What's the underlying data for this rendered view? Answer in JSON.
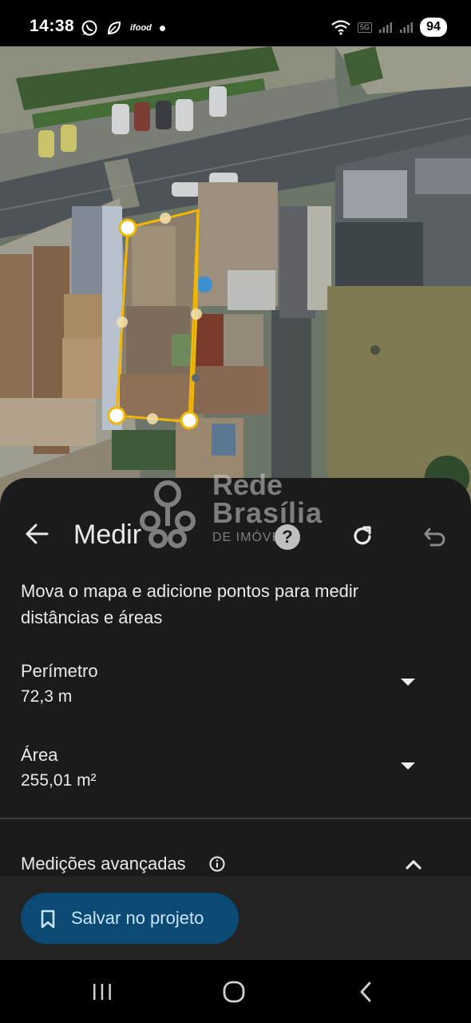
{
  "status_bar": {
    "time": "14:38",
    "left_icons": [
      "whatsapp-icon",
      "leaf-icon",
      "ifood-icon",
      "dot-icon"
    ],
    "ifood_label": "ifood",
    "network_label": "5G",
    "battery": "94"
  },
  "map": {
    "type": "satellite",
    "measurement_color": "#f2b705",
    "point_color": "#ffffff"
  },
  "sheet": {
    "title": "Medir",
    "instructions": "Mova o mapa e adicione pontos para medir distâncias e áreas",
    "perimeter": {
      "label": "Perímetro",
      "value": "72,3 m"
    },
    "area": {
      "label": "Área",
      "value": "255,01 m²"
    },
    "advanced": {
      "label": "Medições avançadas"
    },
    "help_label": "?",
    "watermark": {
      "line1": "Rede",
      "line2": "Brasília",
      "line3": "DE IMÓVEIS"
    }
  },
  "save": {
    "label": "Salvar no projeto",
    "bg_color": "#0b4a73",
    "text_color": "#c8e4ff"
  },
  "nav": {
    "icons": [
      "recent-apps-icon",
      "home-icon",
      "back-nav-icon"
    ]
  }
}
